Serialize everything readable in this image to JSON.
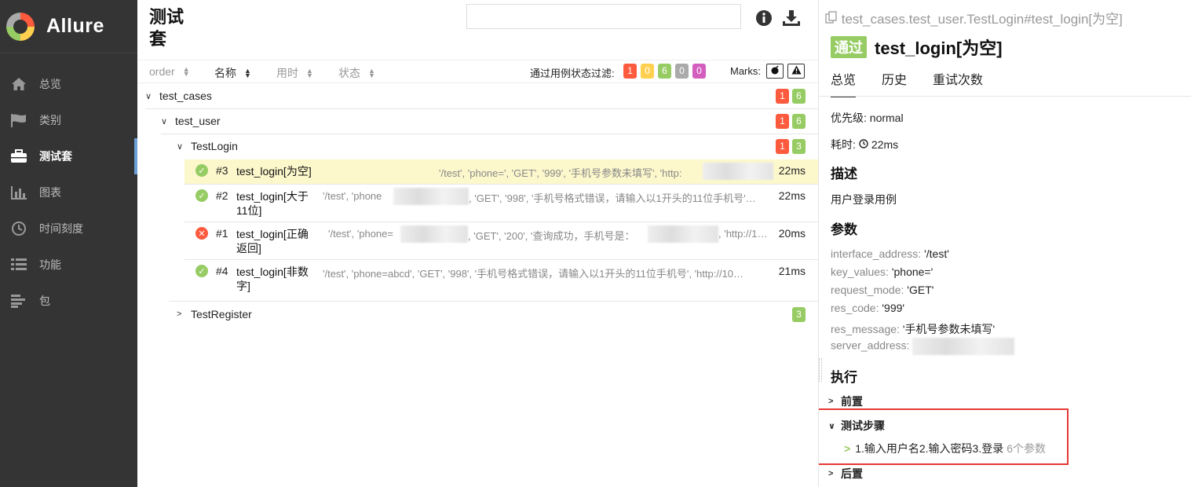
{
  "brand": {
    "name": "Allure"
  },
  "sidebar": {
    "items": [
      {
        "label": "总览",
        "icon": "home-icon"
      },
      {
        "label": "类别",
        "icon": "flag-icon"
      },
      {
        "label": "测试套",
        "icon": "briefcase-icon",
        "active": true
      },
      {
        "label": "图表",
        "icon": "bar-chart-icon"
      },
      {
        "label": "时间刻度",
        "icon": "clock-icon"
      },
      {
        "label": "功能",
        "icon": "list-icon"
      },
      {
        "label": "包",
        "icon": "align-left-icon"
      }
    ]
  },
  "middle": {
    "title_line1": "测试",
    "title_line2": "套",
    "search": {
      "value": "",
      "placeholder": ""
    },
    "sort": {
      "order": "order",
      "name": "名称",
      "duration": "用时",
      "status": "状态"
    },
    "filter_label": "通过用例状态过滤:",
    "filter_counts": [
      "1",
      "0",
      "6",
      "0",
      "0"
    ],
    "marks_label": "Marks:",
    "tree": {
      "suite": {
        "label": "test_cases",
        "counts": [
          "1",
          "6"
        ]
      },
      "module": {
        "label": "test_user",
        "counts": [
          "1",
          "6"
        ]
      },
      "class": {
        "label": "TestLogin",
        "counts": [
          "1",
          "3"
        ]
      },
      "cases": [
        {
          "num": "#3",
          "name": "test_login[为空]",
          "params": "'/test', 'phone=', 'GET', '999', '手机号参数未填写', 'http:",
          "duration": "22ms",
          "status": "passed"
        },
        {
          "num": "#2",
          "name": "test_login[大于11位]",
          "params": "'/test', 'phone",
          "params2": ", 'GET', '998', '手机号格式错误，请输入以1开头的11位手机号'…",
          "duration": "22ms",
          "status": "passed"
        },
        {
          "num": "#1",
          "name": "test_login[正确返回]",
          "params": "'/test', 'phone=",
          "params2": ", 'GET', '200', '查询成功，手机号是：",
          "params3": ", 'http://1…",
          "duration": "20ms",
          "status": "failed"
        },
        {
          "num": "#4",
          "name": "test_login[非数字]",
          "params": "'/test', 'phone=abcd', 'GET', '998', '手机号格式错误，请输入以1开头的11位手机号', 'http://10…",
          "duration": "21ms",
          "status": "passed"
        }
      ],
      "class2": {
        "label": "TestRegister",
        "counts": [
          "3"
        ]
      }
    }
  },
  "right": {
    "breadcrumb": "test_cases.test_user.TestLogin#test_login[为空]",
    "status_badge": "通过",
    "title": "test_login[为空]",
    "tabs": [
      "总览",
      "历史",
      "重试次数"
    ],
    "severity": "优先级: normal",
    "duration_label": "耗时:",
    "duration_value": "22ms",
    "description_heading": "描述",
    "description": "用户登录用例",
    "params_heading": "参数",
    "params": [
      {
        "key": "interface_address",
        "value": "'/test'"
      },
      {
        "key": "key_values",
        "value": "'phone='"
      },
      {
        "key": "request_mode",
        "value": "'GET'"
      },
      {
        "key": "res_code",
        "value": "'999'"
      },
      {
        "key": "res_message",
        "value": "'手机号参数未填写'"
      },
      {
        "key": "server_address",
        "value": ""
      }
    ],
    "execution_heading": "执行",
    "setup": "前置",
    "test_body": "测试步骤",
    "step_name": "1.输入用户名2.输入密码3.登录",
    "step_params": "6个参数",
    "teardown": "后置"
  },
  "colors": {
    "failed": "#fd5a3e",
    "broken": "#ffd050",
    "passed": "#97cc64",
    "skipped": "#aaaaaa",
    "unknown": "#d35ebe",
    "sidebar_bg": "#343434"
  }
}
